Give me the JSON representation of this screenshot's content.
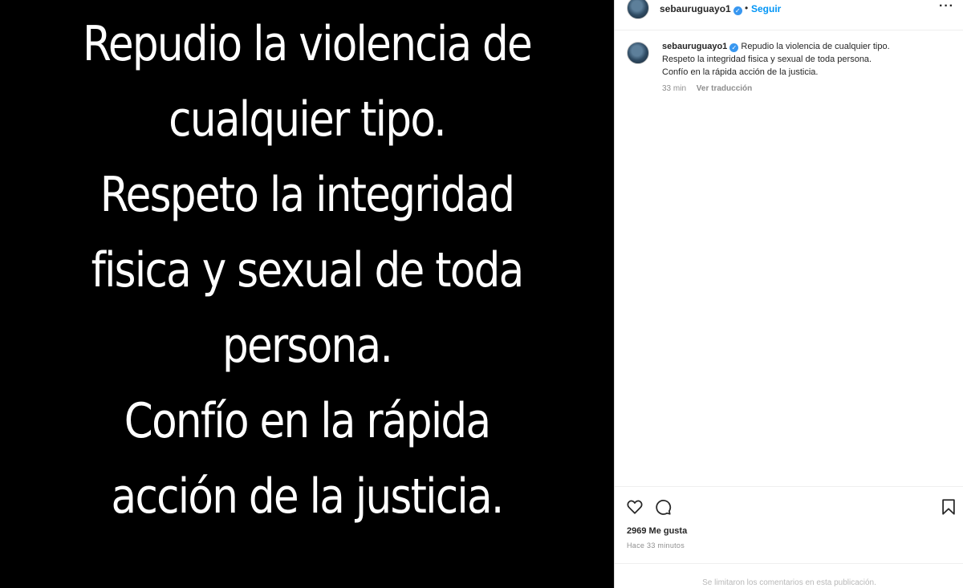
{
  "media": {
    "lines": [
      "Repudio la violencia de",
      "cualquier tipo.",
      "Respeto la integridad",
      "fisica y sexual de toda",
      "persona.",
      "Confío en la rápida",
      "acción de la justicia."
    ]
  },
  "header": {
    "username": "sebauruguayo1",
    "verified_glyph": "✓",
    "separator": "•",
    "follow_label": "Seguir",
    "more_label": "···"
  },
  "caption": {
    "username": "sebauruguayo1",
    "verified_glyph": "✓",
    "line1": "Repudio la violencia de cualquier tipo.",
    "line2": "Respeto la integridad fisica y sexual de toda persona.",
    "line3": "Confío en la rápida acción de la justicia.",
    "time": "33 min",
    "translate_label": "Ver traducción"
  },
  "actions": {
    "icons": [
      "heart-icon",
      "comment-icon",
      "bookmark-icon"
    ]
  },
  "likes_text": "2969 Me gusta",
  "timestamp": "Hace 33 minutos",
  "comments_limited": "Se limitaron los comentarios en esta publicación.",
  "colors": {
    "link": "#0095f6",
    "verified": "#3897f0",
    "media_background": "#000000"
  }
}
